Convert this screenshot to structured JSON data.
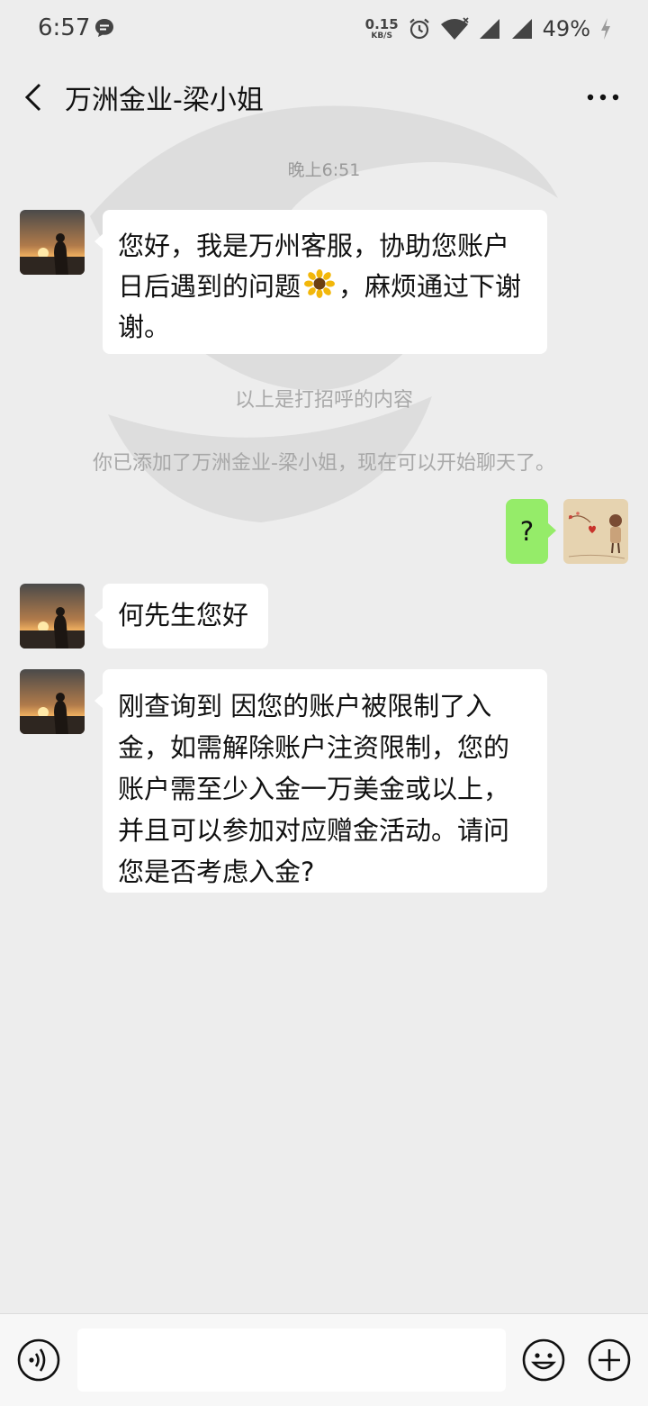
{
  "status_bar": {
    "time": "6:57",
    "net_speed": "0.15",
    "net_unit": "KB/S",
    "battery": "49%"
  },
  "header": {
    "title": "万洲金业-梁小姐"
  },
  "messages": {
    "time_divider": "晚上6:51",
    "greeting_bubble_part1": "您好，我是万州客服，协助您账户日后遇到的问题",
    "greeting_bubble_part2": "，麻烦通过下谢谢。",
    "sys_note_greeting": "以上是打招呼的内容",
    "sys_note_added": "你已添加了万洲金业-梁小姐，现在可以开始聊天了。",
    "my_message": "?",
    "hello_bubble": "何先生您好",
    "long_bubble": "刚查询到 因您的账户被限制了入金，如需解除账户注资限制，您的账户需至少入金一万美金或以上，并且可以参加对应赠金活动。请问您是否考虑入金?"
  },
  "input_bar": {
    "placeholder": ""
  },
  "colors": {
    "background": "#ededed",
    "bubble_received": "#ffffff",
    "bubble_sent": "#95ec69",
    "system_text": "#a8a8a8"
  },
  "icons": {
    "status_chat": "chat-bubble-icon",
    "alarm": "alarm-icon",
    "wifi": "wifi-icon",
    "signal": "signal-icon",
    "charging": "charging-bolt-icon",
    "back": "back-arrow-icon",
    "more": "more-dots-icon",
    "voice": "voice-icon",
    "emoji": "emoji-icon",
    "plus": "plus-icon"
  }
}
